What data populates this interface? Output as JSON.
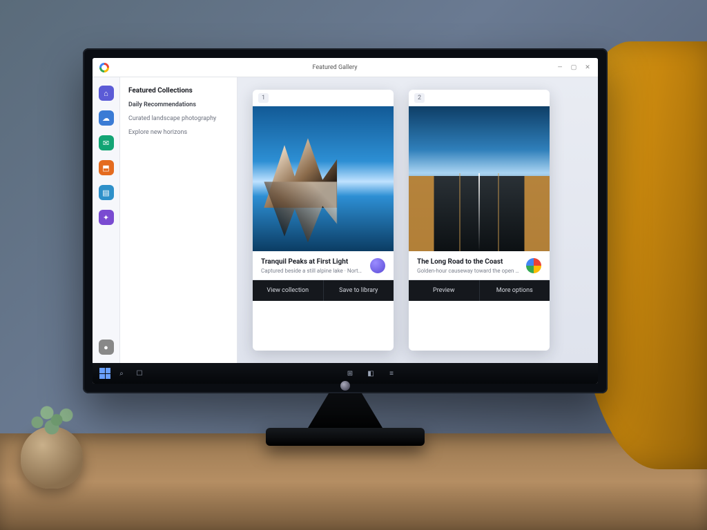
{
  "titlebar": {
    "app_hint": "",
    "center_text": "Featured Gallery",
    "controls": {
      "min": "—",
      "max": "▢",
      "close": "✕"
    }
  },
  "rail": {
    "items": [
      {
        "name": "home",
        "glyph": "⌂"
      },
      {
        "name": "cloud",
        "glyph": "☁"
      },
      {
        "name": "messages",
        "glyph": "✉"
      },
      {
        "name": "store",
        "glyph": "⬒"
      },
      {
        "name": "files",
        "glyph": "▤"
      },
      {
        "name": "apps",
        "glyph": "✦"
      }
    ],
    "footer": {
      "name": "voice",
      "glyph": "●"
    }
  },
  "sidepanel": {
    "heading": "Featured Collections",
    "subheading": "Daily Recommendations",
    "lines": [
      "Curated landscape photography",
      "Explore new horizons"
    ]
  },
  "cards": [
    {
      "tag": "1",
      "title": "Tranquil Peaks at First Light",
      "subtitle": "Captured beside a still alpine lake · Northern Range",
      "avatar": "purple",
      "actions": [
        "View collection",
        "Save to library"
      ]
    },
    {
      "tag": "2",
      "title": "The Long Road to the Coast",
      "subtitle": "Golden-hour causeway toward the open sea",
      "avatar": "multi",
      "actions": [
        "Preview",
        "More options"
      ]
    }
  ],
  "taskbar": {
    "search": "⌕",
    "task": "☐",
    "center": [
      "⊞",
      "◧",
      "≡"
    ]
  }
}
